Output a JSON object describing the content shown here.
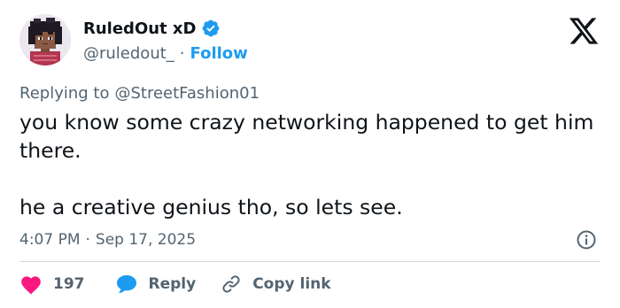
{
  "author": {
    "display_name": "RuledOut xD",
    "handle": "@ruledout_",
    "separator": "·",
    "follow_label": "Follow"
  },
  "reply_context": {
    "prefix": "Replying to",
    "handle": "@StreetFashion01"
  },
  "tweet": {
    "text": "you know some crazy networking happened to get him there.\n\nhe a creative genius tho, so lets see."
  },
  "meta": {
    "time": "4:07 PM",
    "separator": "·",
    "date": "Sep 17, 2025"
  },
  "actions": {
    "like_count": "197",
    "reply_label": "Reply",
    "copy_link_label": "Copy link"
  },
  "colors": {
    "accent": "#1d9bf0",
    "like": "#f91880",
    "text": "#0f1419",
    "muted": "#536471",
    "divider": "#cfd9de"
  },
  "icons": {
    "verified": "verified-badge-icon",
    "brand": "x-logo-icon",
    "info": "info-icon",
    "like": "heart-icon",
    "reply": "reply-bubble-icon",
    "copy": "link-icon"
  }
}
